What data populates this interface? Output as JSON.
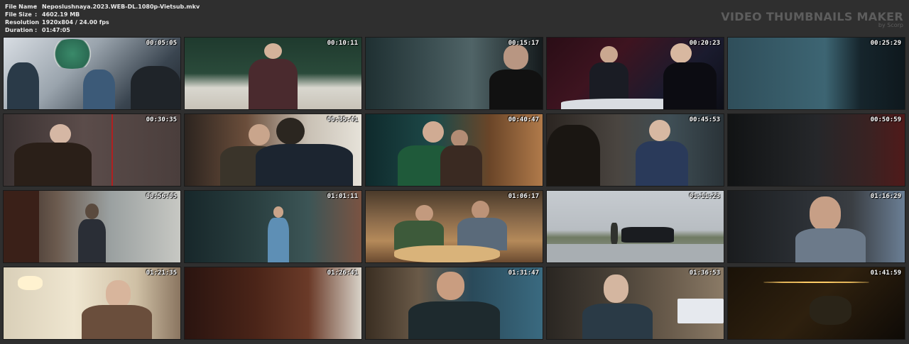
{
  "file_info": {
    "file_name_label": "File Name",
    "file_name": "Neposlushnaya.2023.WEB-DL.1080p-Vietsub.mkv",
    "file_size_label": "File Size",
    "file_size": "4602.19 MB",
    "resolution_label": "Resolution",
    "resolution": "1920x804 / 24.00 fps",
    "duration_label": "Duration",
    "duration": "01:47:05",
    "separator": ":"
  },
  "brand": {
    "title": "VIDEO THUMBNAILS MAKER",
    "subtitle": "by Scorp"
  },
  "thumbnails": [
    {
      "timestamp": "00:05:05",
      "bg": "linear-gradient(135deg,#d8dde3 0%,#9aa4ad 40%,#3a4550 75%,#20262c 100%)",
      "overlay": "sign-green"
    },
    {
      "timestamp": "00:10:11",
      "bg": "linear-gradient(180deg,#1f3a2e 0%,#2a4a3a 50%,#d9d7cf 70%,#c8c3b8 100%)",
      "overlay": "man-center"
    },
    {
      "timestamp": "00:15:17",
      "bg": "linear-gradient(90deg,#1f3032 0%,#3a4d50 35%,#506467 60%,#151b1d 100%)",
      "overlay": "man-right"
    },
    {
      "timestamp": "00:20:23",
      "bg": "linear-gradient(135deg,#2a0d16 0%,#3e1420 35%,#1a1b2e 70%,#0d0e16 100%)",
      "overlay": "bar"
    },
    {
      "timestamp": "00:25:29",
      "bg": "linear-gradient(90deg,#2f4e5a 0%,#3d6573 55%,#16252c 75%,#0e181d 100%)",
      "overlay": "none"
    },
    {
      "timestamp": "00:30:35",
      "bg": "linear-gradient(90deg,#3a3232 0%,#5b4c4a 45%,#4a3e3c 100%)",
      "overlay": "woman-left"
    },
    {
      "timestamp": "00:35:41",
      "bg": "linear-gradient(90deg,#2c241f 0%,#6b4e3b 35%,#c9c1b5 70%,#e6e2d9 100%)",
      "overlay": "two-people"
    },
    {
      "timestamp": "00:40:47",
      "bg": "linear-gradient(90deg,#0f2a2c 0%,#1e4a49 40%,#6a4528 70%,#b07a4a 100%)",
      "overlay": "woman-green"
    },
    {
      "timestamp": "00:45:53",
      "bg": "linear-gradient(90deg,#2b2521 0%,#4a4540 40%,#3f4e55 70%,#2a3338 100%)",
      "overlay": "old-man"
    },
    {
      "timestamp": "00:50:59",
      "bg": "linear-gradient(90deg,#111314 0%,#25272a 50%,#3a2222 80%,#501a1a 100%)",
      "overlay": "none"
    },
    {
      "timestamp": "00:56:05",
      "bg": "linear-gradient(90deg,#2d2320 0%,#6b5a4e 30%,#9aa0a0 60%,#c7c8c3 100%)",
      "overlay": "street"
    },
    {
      "timestamp": "01:01:11",
      "bg": "linear-gradient(90deg,#17272a 0%,#2a3f40 40%,#3c5556 70%,#7a5342 100%)",
      "overlay": "glass"
    },
    {
      "timestamp": "01:06:17",
      "bg": "linear-gradient(180deg,#4a3a2a 0%,#8a6a4a 40%,#b58a5a 70%,#6a4a30 100%)",
      "overlay": "dinner"
    },
    {
      "timestamp": "01:11:23",
      "bg": "linear-gradient(180deg,#c6cbd0 0%,#b8bdc2 55%,#6f7a62 65%,#9aa0a2 100%)",
      "overlay": "car"
    },
    {
      "timestamp": "01:16:29",
      "bg": "linear-gradient(90deg,#1a1c1e 0%,#2a2e33 40%,#3a3e43 70%,#6b7f95 100%)",
      "overlay": "man-right2"
    },
    {
      "timestamp": "01:21:35",
      "bg": "linear-gradient(90deg,#d9cfb8 0%,#efe6d0 40%,#cfc0a5 75%,#8a7560 100%)",
      "overlay": "woman-portrait"
    },
    {
      "timestamp": "01:26:41",
      "bg": "linear-gradient(90deg,#2a1410 0%,#4a2418 40%,#6a3a28 70%,#d8d2c8 100%)",
      "overlay": "none"
    },
    {
      "timestamp": "01:31:47",
      "bg": "linear-gradient(90deg,#3a2e22 0%,#6a5a48 30%,#2a4a5a 60%,#3a6a80 100%)",
      "overlay": "phone"
    },
    {
      "timestamp": "01:36:53",
      "bg": "linear-gradient(90deg,#2a2622 0%,#4a4238 40%,#6a5c4c 70%,#8a7a66 100%)",
      "overlay": "sign-white"
    },
    {
      "timestamp": "01:41:59",
      "bg": "linear-gradient(135deg,#1a1208 0%,#2e200e 50%,#0e0a06 100%)",
      "overlay": "dark-lights"
    }
  ]
}
